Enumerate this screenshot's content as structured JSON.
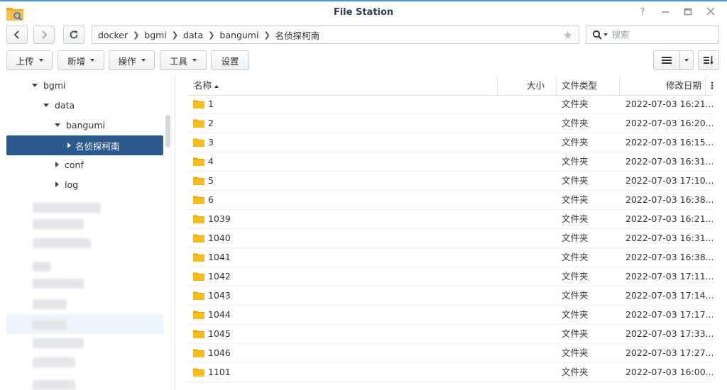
{
  "window": {
    "title": "File Station"
  },
  "path": {
    "crumbs": [
      "docker",
      "bgmi",
      "data",
      "bangumi",
      "名侦探柯南"
    ]
  },
  "search": {
    "placeholder": "搜索"
  },
  "toolbar": {
    "upload_label": "上传",
    "create_label": "新增",
    "action_label": "操作",
    "tools_label": "工具",
    "settings_label": "设置"
  },
  "tree": {
    "bgmi": "bgmi",
    "data": "data",
    "bangumi": "bangumi",
    "selected": "名侦探柯南",
    "conf": "conf",
    "log": "log"
  },
  "columns": {
    "name": "名称",
    "size": "大小",
    "type": "文件类型",
    "modified": "修改日期"
  },
  "files": [
    {
      "name": "1",
      "size": "",
      "type": "文件夹",
      "modified": "2022-07-03 16:21..."
    },
    {
      "name": "2",
      "size": "",
      "type": "文件夹",
      "modified": "2022-07-03 16:20..."
    },
    {
      "name": "3",
      "size": "",
      "type": "文件夹",
      "modified": "2022-07-03 16:15..."
    },
    {
      "name": "4",
      "size": "",
      "type": "文件夹",
      "modified": "2022-07-03 16:31..."
    },
    {
      "name": "5",
      "size": "",
      "type": "文件夹",
      "modified": "2022-07-03 17:10..."
    },
    {
      "name": "6",
      "size": "",
      "type": "文件夹",
      "modified": "2022-07-03 16:38..."
    },
    {
      "name": "1039",
      "size": "",
      "type": "文件夹",
      "modified": "2022-07-03 16:21..."
    },
    {
      "name": "1040",
      "size": "",
      "type": "文件夹",
      "modified": "2022-07-03 16:31..."
    },
    {
      "name": "1041",
      "size": "",
      "type": "文件夹",
      "modified": "2022-07-03 16:38..."
    },
    {
      "name": "1042",
      "size": "",
      "type": "文件夹",
      "modified": "2022-07-03 17:11..."
    },
    {
      "name": "1043",
      "size": "",
      "type": "文件夹",
      "modified": "2022-07-03 17:14..."
    },
    {
      "name": "1044",
      "size": "",
      "type": "文件夹",
      "modified": "2022-07-03 17:17..."
    },
    {
      "name": "1045",
      "size": "",
      "type": "文件夹",
      "modified": "2022-07-03 17:33..."
    },
    {
      "name": "1046",
      "size": "",
      "type": "文件夹",
      "modified": "2022-07-03 17:27..."
    },
    {
      "name": "1101",
      "size": "",
      "type": "文件夹",
      "modified": "2022-07-03 16:00..."
    }
  ],
  "colors": {
    "accent": "#2d5a8e",
    "folder": "#f5b400",
    "title": "#2c3e50"
  }
}
